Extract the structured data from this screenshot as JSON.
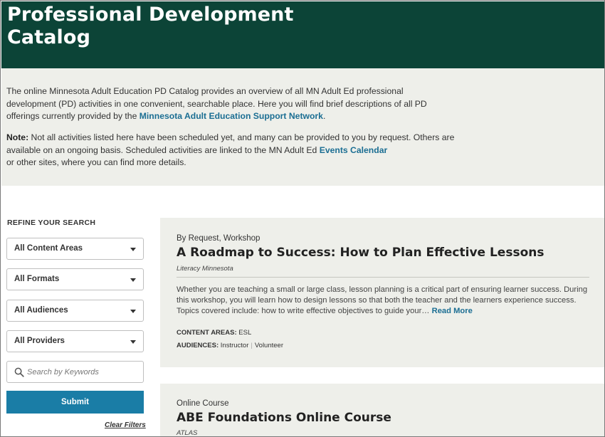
{
  "header": {
    "title_line1": "Professional Development",
    "title_line2": "Catalog"
  },
  "intro": {
    "p1_before": "The online Minnesota Adult Education PD Catalog provides an overview of all MN Adult Ed professional development (PD) activities in one convenient, searchable place. Here you will find brief descriptions of all PD offerings currently provided by the ",
    "p1_link": "Minnesota Adult Education Support Network",
    "p1_after": ".",
    "p2_label": "Note:",
    "p2_before": " Not all activities listed here have been scheduled yet, and many can be provided to you by request. Others are available on an ongoing basis. Scheduled activities are linked to the MN Adult Ed ",
    "p2_link": "Events Calendar",
    "p2_after": " or other sites, where you can find more details."
  },
  "sidebar": {
    "title": "REFINE YOUR SEARCH",
    "filters": [
      {
        "label": "All Content Areas"
      },
      {
        "label": "All Formats"
      },
      {
        "label": "All Audiences"
      },
      {
        "label": "All Providers"
      }
    ],
    "search_placeholder": "Search by Keywords",
    "submit_label": "Submit",
    "clear_label": "Clear Filters"
  },
  "results": [
    {
      "type": "By Request, Workshop",
      "title": "A Roadmap to Success: How to Plan Effective Lessons",
      "provider": "Literacy Minnesota",
      "description": "Whether you are teaching a small or large class, lesson planning is a critical part of ensuring learner success. During this workshop, you will learn how to design lessons so that both the teacher and the learners experience success. Topics covered include: how to write effective objectives to guide your…",
      "read_more": "Read More",
      "content_areas_label": "CONTENT AREAS:",
      "content_areas": "ESL",
      "audiences_label": "AUDIENCES:",
      "audience_1": "Instructor",
      "audience_sep": "|",
      "audience_2": "Volunteer"
    },
    {
      "type": "Online Course",
      "title": "ABE Foundations Online Course",
      "provider": "ATLAS"
    }
  ],
  "colors": {
    "header_bg": "#0c4437",
    "panel_bg": "#eeefea",
    "link": "#1b6e93",
    "button": "#1a7da6"
  }
}
